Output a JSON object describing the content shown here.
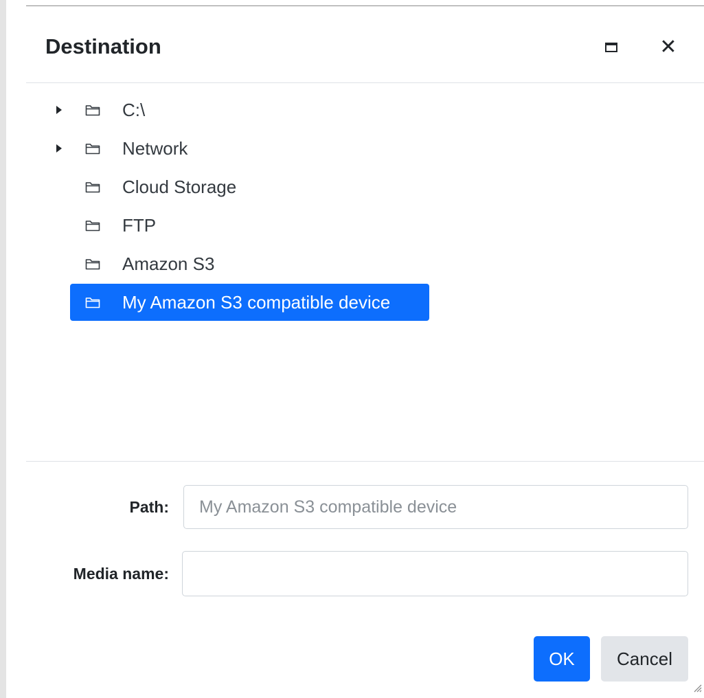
{
  "dialog": {
    "title": "Destination",
    "maximize_icon": "maximize-icon",
    "close_icon": "close-icon",
    "close_glyph": "✕"
  },
  "tree": {
    "folder_icon": "folder-icon",
    "items": [
      {
        "label": "C:\\",
        "expandable": true,
        "selected": false
      },
      {
        "label": "Network",
        "expandable": true,
        "selected": false
      },
      {
        "label": "Cloud Storage",
        "expandable": false,
        "selected": false
      },
      {
        "label": "FTP",
        "expandable": false,
        "selected": false
      },
      {
        "label": "Amazon S3",
        "expandable": false,
        "selected": false
      },
      {
        "label": "My Amazon S3 compatible device",
        "expandable": false,
        "selected": true
      }
    ]
  },
  "form": {
    "path_label": "Path:",
    "path_value": "",
    "path_placeholder": "My Amazon S3 compatible device",
    "media_name_label": "Media name:",
    "media_name_value": ""
  },
  "buttons": {
    "ok_label": "OK",
    "cancel_label": "Cancel"
  },
  "colors": {
    "accent": "#0d6efd",
    "selected_text": "#ffffff",
    "cancel_bg": "#e2e5e9"
  }
}
